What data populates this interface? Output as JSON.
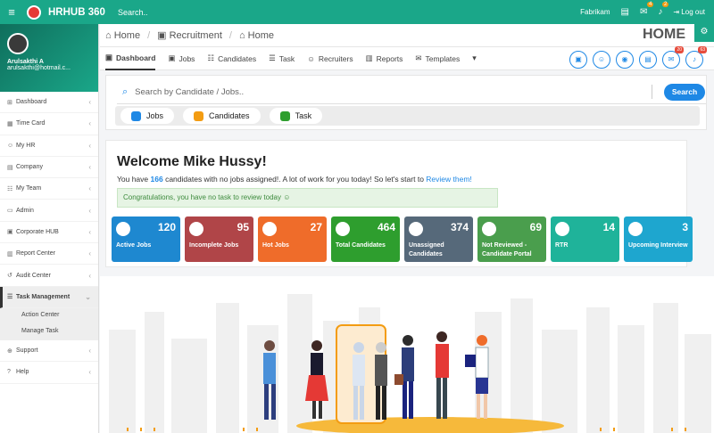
{
  "topbar": {
    "app_name": "HRHUB 360",
    "search_label": "Search..",
    "company": "Fabrikam",
    "msg_badge": "4",
    "bell_badge": "2",
    "logout_label": "Log out"
  },
  "profile": {
    "name": "Arulsakthi A",
    "email": "arulsakthi@hotmail.c..."
  },
  "menu": [
    {
      "label": "Dashboard",
      "icon": "dashboard-icon",
      "glyph": "⊞"
    },
    {
      "label": "Time Card",
      "icon": "calendar-icon",
      "glyph": "▦"
    },
    {
      "label": "My HR",
      "icon": "user-icon",
      "glyph": "☺"
    },
    {
      "label": "Company",
      "icon": "building-icon",
      "glyph": "▤"
    },
    {
      "label": "My Team",
      "icon": "team-icon",
      "glyph": "☷"
    },
    {
      "label": "Admin",
      "icon": "admin-icon",
      "glyph": "▭"
    },
    {
      "label": "Corporate HUB",
      "icon": "hub-icon",
      "glyph": "▣"
    },
    {
      "label": "Report Center",
      "icon": "report-icon",
      "glyph": "▥"
    },
    {
      "label": "Audit Center",
      "icon": "audit-icon",
      "glyph": "↺"
    },
    {
      "label": "Task Management",
      "icon": "task-icon",
      "glyph": "☰"
    },
    {
      "label": "Action Center"
    },
    {
      "label": "Manage Task"
    },
    {
      "label": "Support",
      "icon": "support-icon",
      "glyph": "⊕"
    },
    {
      "label": "Help",
      "icon": "help-icon",
      "glyph": "?"
    }
  ],
  "breadcrumb": {
    "items": [
      "Home",
      "Recruitment",
      "Home"
    ]
  },
  "page": {
    "heading": "HOME"
  },
  "tabs": [
    "Dashboard",
    "Jobs",
    "Candidates",
    "Task",
    "Recruiters",
    "Reports",
    "Templates"
  ],
  "round_buttons": {
    "email_badge": "20",
    "bell_badge": "63"
  },
  "search": {
    "placeholder": "Search by Candidate / Jobs..",
    "button": "Search"
  },
  "filters": [
    "Jobs",
    "Candidates",
    "Task"
  ],
  "welcome": {
    "title": "Welcome Mike Hussy!",
    "text_pre": "You have",
    "count": "166",
    "text_post": "candidates with no jobs assigned!. A lot of work for you today! So let's start to",
    "link": "Review them!",
    "congrats": "Congratulations, you have no task to review today ☺"
  },
  "cards": [
    {
      "label": "Active Jobs",
      "value": "120",
      "color": "#1e88d0"
    },
    {
      "label": "Incomplete Jobs",
      "value": "95",
      "color": "#b04548"
    },
    {
      "label": "Hot Jobs",
      "value": "27",
      "color": "#ef6c2a"
    },
    {
      "label": "Total Candidates",
      "value": "464",
      "color": "#2e9e2e"
    },
    {
      "label": "Unassigned Candidates",
      "value": "374",
      "color": "#56697a"
    },
    {
      "label": "Not Reviewed - Candidate Portal",
      "value": "69",
      "color": "#4a9e4d"
    },
    {
      "label": "RTR",
      "value": "14",
      "color": "#1fb39a"
    },
    {
      "label": "Upcoming Interview",
      "value": "3",
      "color": "#1ea6cf"
    }
  ]
}
